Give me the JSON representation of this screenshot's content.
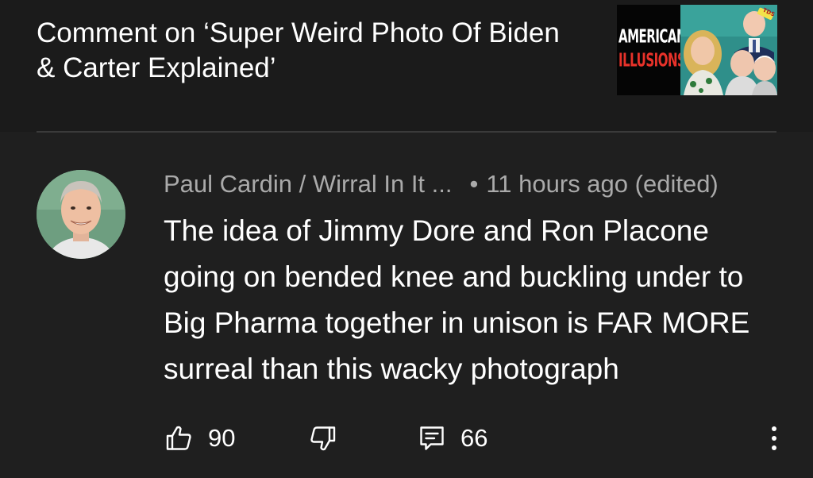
{
  "header": {
    "title": "Comment on ‘Super Weird Photo Of Biden & Carter Explained’",
    "thumbnail": {
      "line1": "AMERICAN",
      "line2": "ILLUSIONS",
      "badge_text": "TDS"
    }
  },
  "comment": {
    "author": "Paul Cardin / Wirral In It ...",
    "separator": "•",
    "time": "11 hours ago (edited)",
    "text": "The idea of Jimmy Dore and Ron Placone going on bended knee and buckling under to Big Pharma together in unison is FAR MORE surreal than this wacky photograph",
    "avatar_icon": "user-avatar"
  },
  "actions": {
    "likes": "90",
    "replies": "66",
    "icons": {
      "like": "thumbs-up-icon",
      "dislike": "thumbs-down-icon",
      "reply": "comment-icon",
      "more": "more-vert-icon"
    }
  },
  "colors": {
    "background": "#1f1f1f",
    "header_background": "#1b1b1b",
    "meta_text": "#aaaaaa",
    "text": "#ffffff",
    "divider": "#3a3a3a"
  }
}
